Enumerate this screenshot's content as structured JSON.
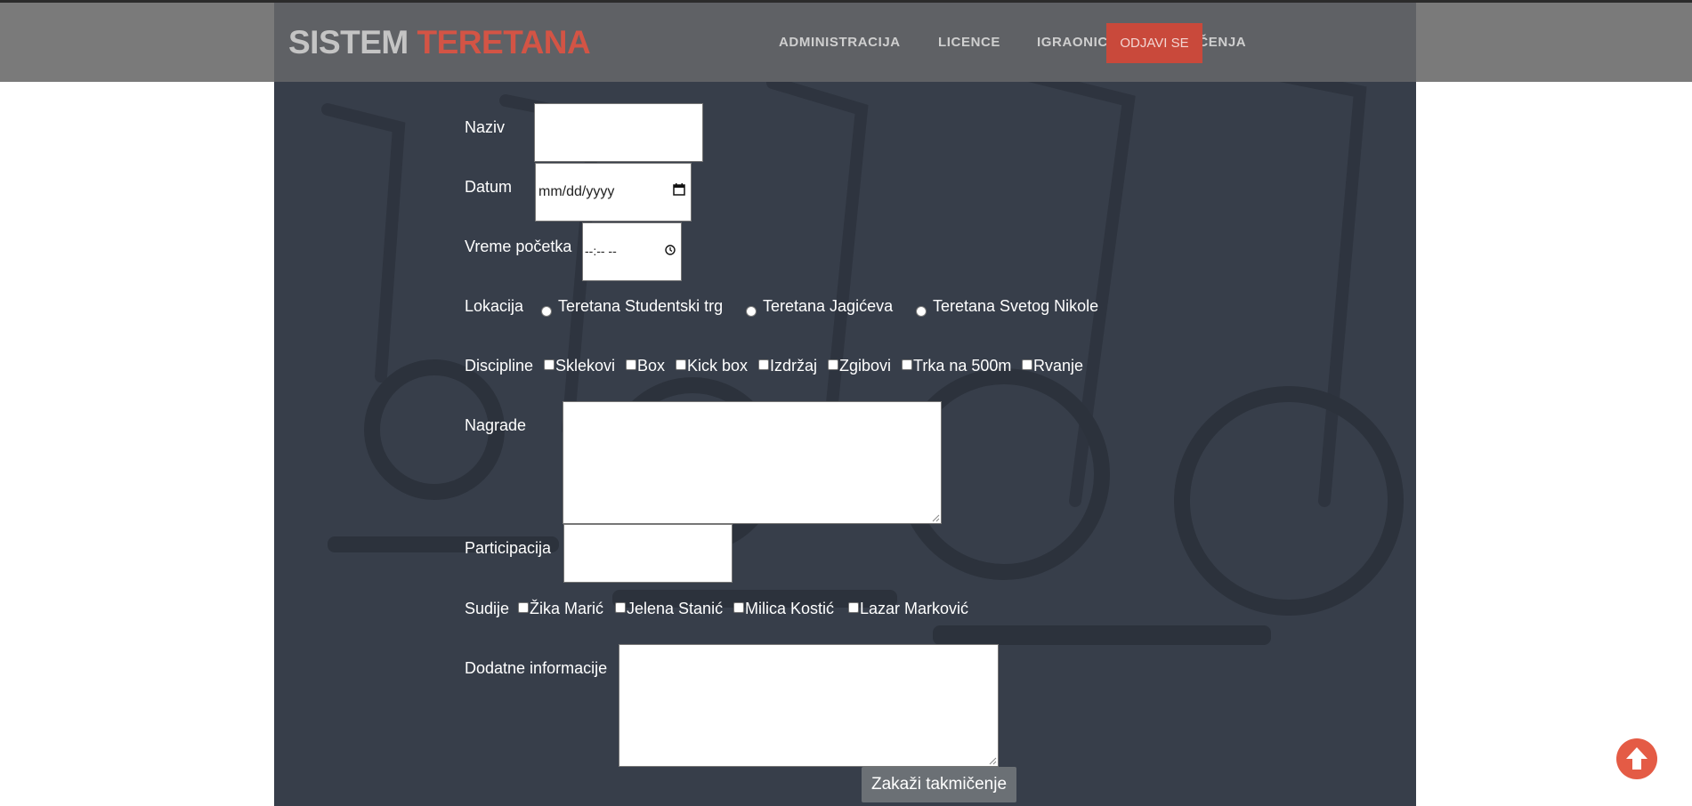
{
  "header": {
    "logo_part1": "SISTEM",
    "logo_part2": "TERETANA",
    "nav": [
      "ADMINISTRACIJA",
      "LICENCE",
      "IGRAONICA",
      "TAKMIČENJA"
    ],
    "logout_label": "ODJAVI SE"
  },
  "form": {
    "naziv_label": "Naziv",
    "naziv_value": "",
    "datum_label": "Datum",
    "datum_placeholder": "mm/dd/yyyy",
    "vreme_label": "Vreme početka",
    "vreme_placeholder": "--:-- --",
    "lokacija_label": "Lokacija",
    "lokacije": [
      "Teretana Studentski trg",
      "Teretana Jagićeva",
      "Teretana Svetog Nikole"
    ],
    "discipline_label": "Discipline",
    "discipline": [
      "Sklekovi",
      "Box",
      "Kick box",
      "Izdržaj",
      "Zgibovi",
      "Trka na 500m",
      "Rvanje"
    ],
    "nagrade_label": "Nagrade",
    "participacija_label": "Participacija",
    "sudije_label": "Sudije",
    "sudije": [
      "Žika Marić",
      "Jelena Stanić",
      "Milica Kostić",
      "Lazar Marković"
    ],
    "dodatne_label": "Dodatne informacije",
    "submit_label": "Zakaži takmičenje"
  },
  "colors": {
    "brand_red": "#d35445",
    "background": "#353c48",
    "header_bg": "#5f6165"
  },
  "icons": {
    "scroll_top": "arrow-up-circle-icon",
    "calendar": "calendar-icon",
    "clock": "clock-icon"
  }
}
